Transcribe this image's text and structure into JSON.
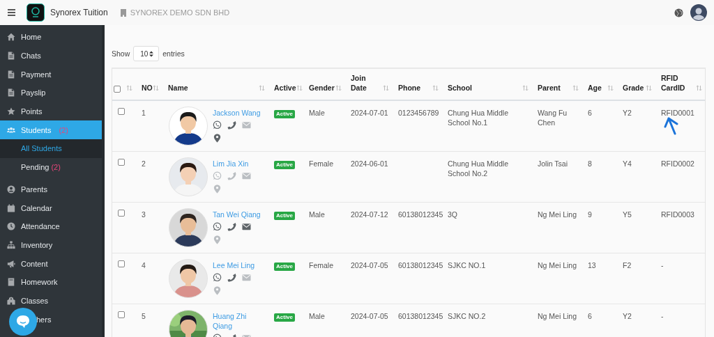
{
  "topbar": {
    "brand": "Synorex Tuition",
    "company": "SYNOREX DEMO SDN BHD"
  },
  "sidebar": {
    "items": [
      {
        "kind": "item",
        "label": "Home",
        "selected": false
      },
      {
        "kind": "item",
        "label": "Chats",
        "selected": false
      },
      {
        "kind": "item",
        "label": "Payment",
        "selected": false
      },
      {
        "kind": "item",
        "label": "Payslip",
        "selected": false
      },
      {
        "kind": "item",
        "label": "Points",
        "selected": false
      },
      {
        "kind": "item",
        "label": "Students",
        "badge": "(2)",
        "selected": true,
        "children": [
          {
            "label": "All Students",
            "selected": true
          },
          {
            "label": "Pending",
            "badge": "(2)",
            "selected": false
          }
        ]
      },
      {
        "kind": "item",
        "label": "Parents",
        "selected": false
      },
      {
        "kind": "item",
        "label": "Calendar",
        "selected": false
      },
      {
        "kind": "item",
        "label": "Attendance",
        "selected": false
      },
      {
        "kind": "item",
        "label": "Inventory",
        "selected": false
      },
      {
        "kind": "item",
        "label": "Content",
        "selected": false
      },
      {
        "kind": "item",
        "label": "Homework",
        "selected": false
      },
      {
        "kind": "item",
        "label": "Classes",
        "selected": false
      },
      {
        "kind": "covered",
        "label": "hers",
        "selected": false
      }
    ]
  },
  "entries": {
    "before": "Show",
    "value": "10",
    "after": "entries"
  },
  "table": {
    "select_all": {
      "checked": false
    },
    "columns": [
      {
        "label": "NO"
      },
      {
        "label": "Name"
      },
      {
        "label": "Active"
      },
      {
        "label": "Gender"
      },
      {
        "label": "Join Date"
      },
      {
        "label": "Phone"
      },
      {
        "label": "School"
      },
      {
        "label": "Parent"
      },
      {
        "label": "Age"
      },
      {
        "label": "Grade"
      },
      {
        "label": "RFID CardID"
      }
    ],
    "rows": [
      {
        "checked": false,
        "no": "1",
        "name": "Jackson Wang",
        "contacts": [
          {
            "kind": "whatsapp",
            "available": true
          },
          {
            "kind": "phone",
            "available": true
          },
          {
            "kind": "email",
            "available": false
          },
          {
            "kind": "location",
            "available": true
          }
        ],
        "status": "Active",
        "gender": "Male",
        "join_date": "2024-07-01",
        "phone": "0123456789",
        "school": "Chung Hua Middle School No.1",
        "parent": "Wang Fu Chen",
        "age": "6",
        "grade": "Y2",
        "rfid": "RFID0001",
        "marked": true
      },
      {
        "checked": false,
        "no": "2",
        "name": "Lim Jia Xin",
        "contacts": [
          {
            "kind": "whatsapp",
            "available": false
          },
          {
            "kind": "phone",
            "available": false
          },
          {
            "kind": "email",
            "available": false
          },
          {
            "kind": "location",
            "available": false
          }
        ],
        "status": "Active",
        "gender": "Female",
        "join_date": "2024-06-01",
        "school": "Chung Hua Middle School No.2",
        "parent": "Jolin Tsai",
        "age": "8",
        "grade": "Y4",
        "rfid": "RFID0002",
        "marked": false
      },
      {
        "checked": false,
        "no": "3",
        "name": "Tan Wei Qiang",
        "contacts": [
          {
            "kind": "whatsapp",
            "available": true
          },
          {
            "kind": "phone",
            "available": true
          },
          {
            "kind": "email",
            "available": true
          },
          {
            "kind": "location",
            "available": false
          }
        ],
        "status": "Active",
        "gender": "Male",
        "join_date": "2024-07-12",
        "phone": "60138012345",
        "school": "3Q",
        "parent": "Ng Mei Ling",
        "age": "9",
        "grade": "Y5",
        "rfid": "RFID0003",
        "marked": false
      },
      {
        "checked": false,
        "no": "4",
        "name": "Lee Mei Ling",
        "contacts": [
          {
            "kind": "whatsapp",
            "available": true
          },
          {
            "kind": "phone",
            "available": true
          },
          {
            "kind": "email",
            "available": false
          },
          {
            "kind": "location",
            "available": false
          }
        ],
        "status": "Active",
        "gender": "Female",
        "join_date": "2024-07-05",
        "phone": "60138012345",
        "school": "SJKC NO.1",
        "parent": "Ng Mei Ling",
        "age": "13",
        "grade": "F2",
        "rfid": "-",
        "marked": false
      },
      {
        "checked": false,
        "no": "5",
        "name": "Huang Zhi Qiang",
        "contacts": [
          {
            "kind": "whatsapp",
            "available": true
          },
          {
            "kind": "phone",
            "available": true
          },
          {
            "kind": "email",
            "available": false
          }
        ],
        "status": "Active",
        "gender": "Male",
        "join_date": "2024-07-05",
        "phone": "60138012345",
        "school": "SJKC NO.2",
        "parent": "Ng Mei Ling",
        "age": "6",
        "grade": "Y2",
        "rfid": "-",
        "marked": false
      }
    ]
  }
}
